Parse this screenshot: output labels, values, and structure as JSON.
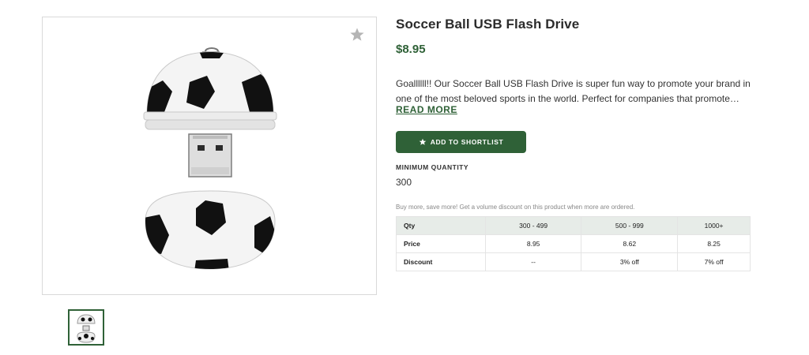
{
  "product": {
    "title": "Soccer Ball USB Flash Drive",
    "price": "$8.95",
    "description": "Goallllll!! Our Soccer Ball USB Flash Drive is super fun way to promote your brand in one of the most beloved sports in the world. Perfect for companies that promote…",
    "read_more_label": "READ MORE",
    "shortlist_label": "ADD TO SHORTLIST",
    "min_quantity_label": "MINIMUM QUANTITY",
    "min_quantity_value": "300",
    "volume_note": "Buy more, save more! Get a volume discount on this product when more are ordered."
  },
  "pricing_table": {
    "header": [
      "Qty",
      "300 - 499",
      "500 - 999",
      "1000+"
    ],
    "rows": [
      [
        "Price",
        "8.95",
        "8.62",
        "8.25"
      ],
      [
        "Discount",
        "--",
        "3% off",
        "7% off"
      ]
    ]
  },
  "icons": {
    "favorite": "star-icon",
    "shortlist": "star-icon"
  },
  "colors": {
    "accent": "#2f6137",
    "table_header_bg": "#e7ece8",
    "favorite_star": "#b5b5b5"
  }
}
